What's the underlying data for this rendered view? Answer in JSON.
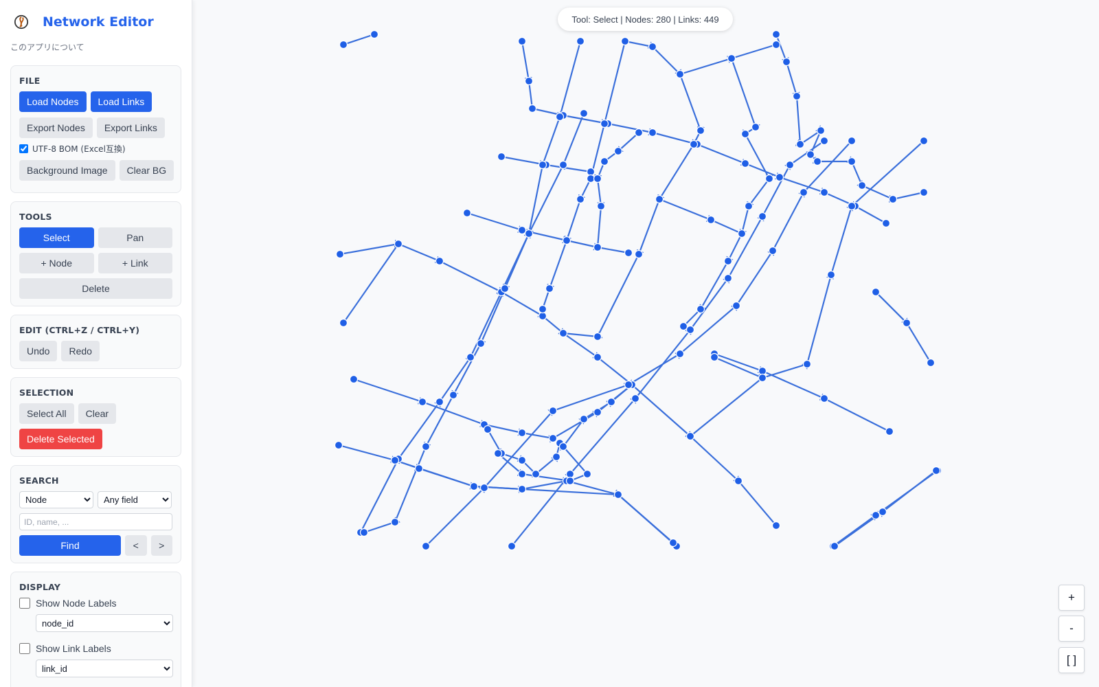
{
  "app": {
    "title": "Network Editor",
    "about_link": "このアプリについて"
  },
  "file_panel": {
    "title": "FILE",
    "load_nodes": "Load Nodes",
    "load_links": "Load Links",
    "export_nodes": "Export Nodes",
    "export_links": "Export Links",
    "bom_label": "UTF-8 BOM (Excel互換)",
    "bom_checked": true,
    "background_image": "Background Image",
    "clear_bg": "Clear BG"
  },
  "tools_panel": {
    "title": "TOOLS",
    "select": "Select",
    "pan": "Pan",
    "add_node": "+ Node",
    "add_link": "+ Link",
    "delete": "Delete",
    "active_tool": "Select"
  },
  "edit_panel": {
    "title": "EDIT (CTRL+Z / CTRL+Y)",
    "undo": "Undo",
    "redo": "Redo"
  },
  "selection_panel": {
    "title": "SELECTION",
    "select_all": "Select All",
    "clear": "Clear",
    "delete_selected": "Delete Selected"
  },
  "search_panel": {
    "title": "SEARCH",
    "type_selected": "Node",
    "field_selected": "Any field",
    "query_placeholder": "ID, name, ...",
    "find": "Find",
    "prev": "<",
    "next": ">"
  },
  "display_panel": {
    "title": "DISPLAY",
    "show_node_labels": "Show Node Labels",
    "node_label_field": "node_id",
    "show_link_labels": "Show Link Labels",
    "link_label_field": "link_id"
  },
  "status": {
    "text": "Tool: Select | Nodes: 280 | Links: 449"
  },
  "zoom": {
    "in": "+",
    "out": "-",
    "fit": "[ ]"
  },
  "colors": {
    "accent": "#2563eb",
    "danger": "#ef4444",
    "link": "#3a6fdb",
    "node": "#1f5fe6"
  }
}
